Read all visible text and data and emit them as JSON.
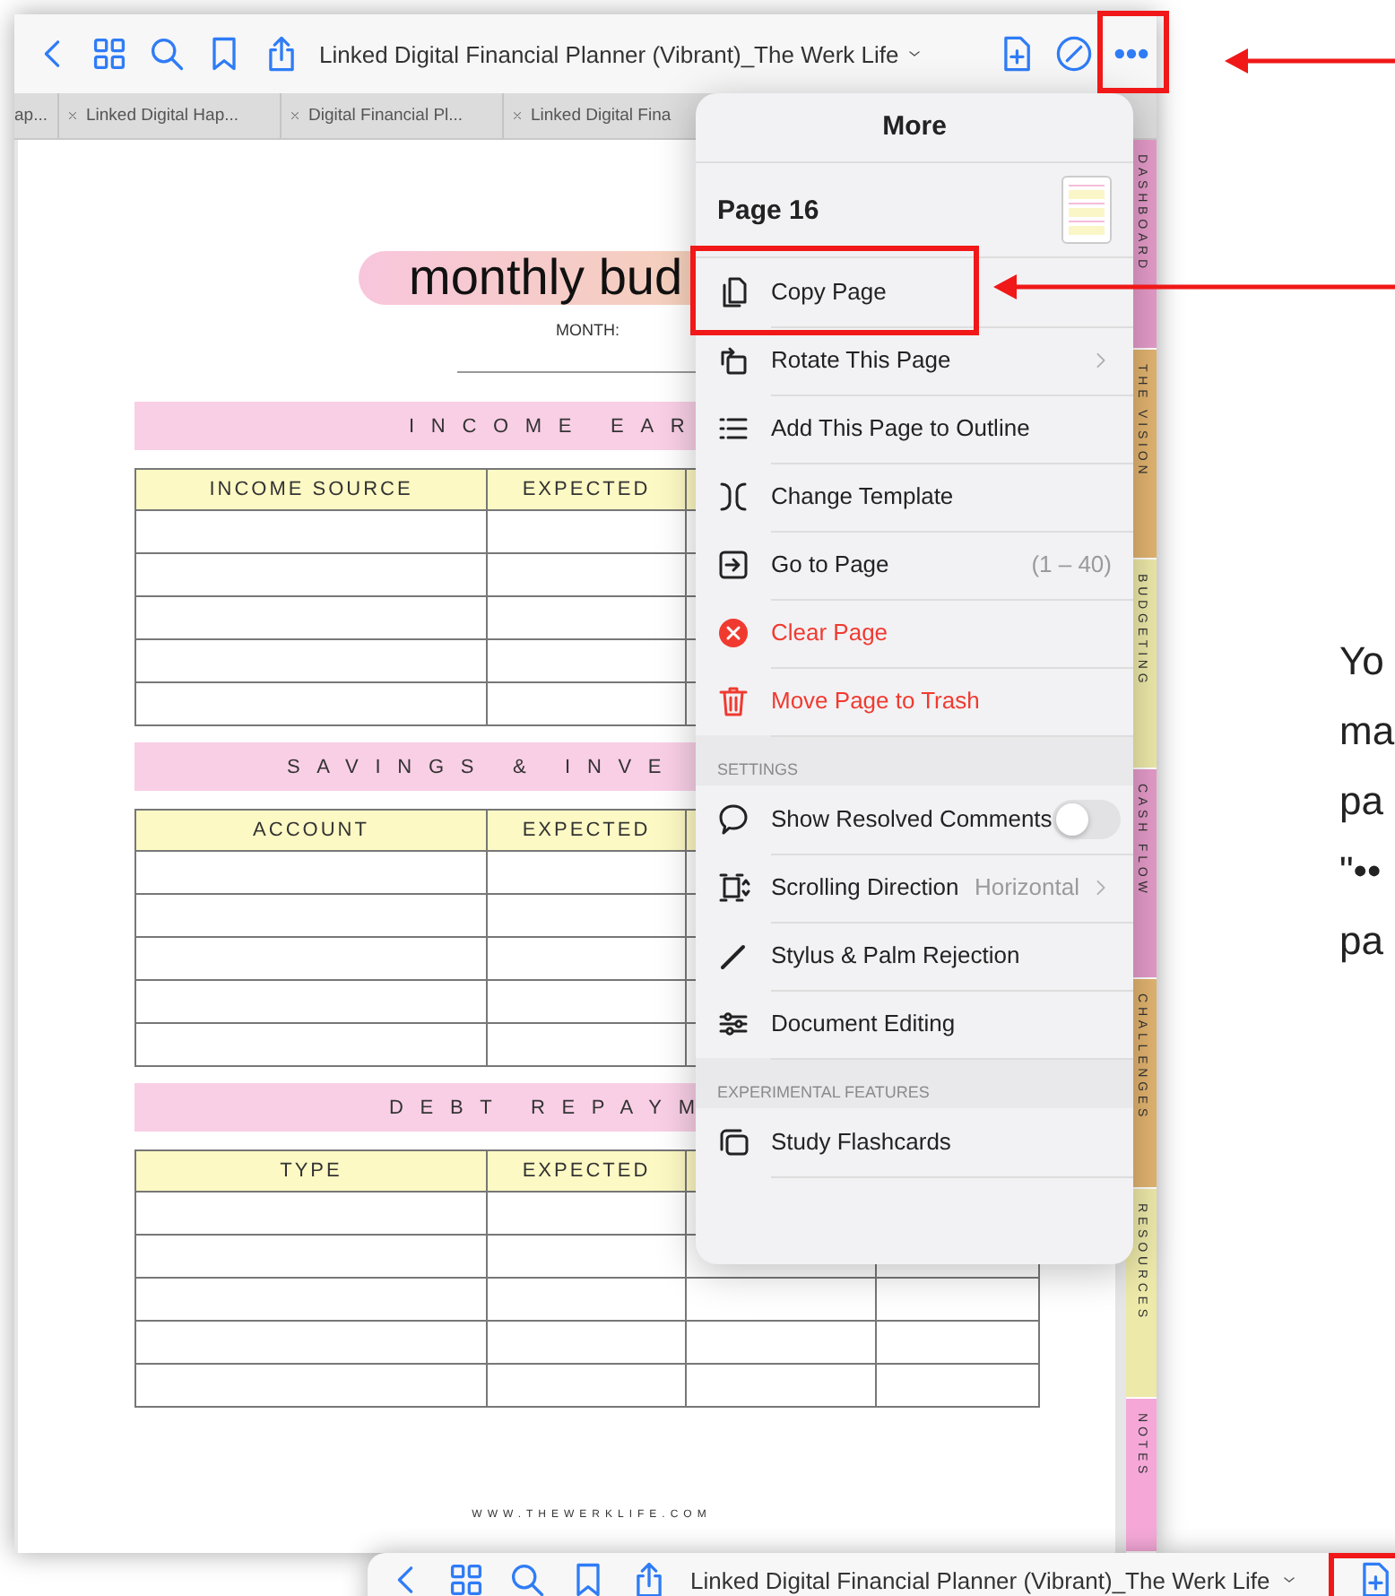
{
  "toolbar": {
    "title": "Linked Digital Financial Planner (Vibrant)_The Werk Life"
  },
  "tabs": [
    {
      "label": "ap...",
      "closable": false
    },
    {
      "label": "Linked Digital Hap...",
      "closable": true
    },
    {
      "label": "Digital Financial Pl...",
      "closable": true
    },
    {
      "label": "Linked Digital Fina",
      "closable": true
    }
  ],
  "page": {
    "title": "monthly bud",
    "month_label": "MONTH:",
    "sections": [
      {
        "title": "INCOME EAR",
        "columns": [
          "INCOME SOURCE",
          "EXPECTED"
        ]
      },
      {
        "title": "SAVINGS & INVE",
        "columns": [
          "ACCOUNT",
          "EXPECTED"
        ]
      },
      {
        "title": "DEBT REPAYM",
        "columns": [
          "TYPE",
          "EXPECTED"
        ]
      }
    ],
    "footer": "WWW.THEWERKLIFE.COM"
  },
  "section_tabs": [
    {
      "label": "DASHBOARD",
      "color": "#e59bc9"
    },
    {
      "label": "THE VISION",
      "color": "#e2b46f"
    },
    {
      "label": "BUDGETING",
      "color": "#ede9a9"
    },
    {
      "label": "CASH FLOW",
      "color": "#e59bc9"
    },
    {
      "label": "CHALLENGES",
      "color": "#e2b46f"
    },
    {
      "label": "RESOURCES",
      "color": "#ede9a9"
    },
    {
      "label": "NOTES",
      "color": "#f5a8d8"
    }
  ],
  "menu": {
    "title": "More",
    "page_label": "Page 16",
    "groups": [
      {
        "items": [
          {
            "label": "Copy Page",
            "kind": "action",
            "disclosure": false
          },
          {
            "label": "Rotate This Page",
            "kind": "action",
            "disclosure": true
          },
          {
            "label": "Add This Page to Outline",
            "kind": "action",
            "disclosure": false
          },
          {
            "label": "Change Template",
            "kind": "action",
            "disclosure": false
          },
          {
            "label": "Go to Page",
            "kind": "action",
            "detail": "(1 – 40)",
            "disclosure": false
          },
          {
            "label": "Clear Page",
            "kind": "destructive",
            "disclosure": false
          },
          {
            "label": "Move Page to Trash",
            "kind": "destructive",
            "disclosure": false
          }
        ]
      },
      {
        "header": "SETTINGS",
        "items": [
          {
            "label": "Show Resolved Comments",
            "kind": "toggle",
            "on": false,
            "disclosure": false
          },
          {
            "label": "Scrolling Direction",
            "kind": "action",
            "detail": "Horizontal",
            "disclosure": true
          },
          {
            "label": "Stylus & Palm Rejection",
            "kind": "action",
            "disclosure": false
          },
          {
            "label": "Document Editing",
            "kind": "action",
            "disclosure": false
          }
        ]
      },
      {
        "header": "EXPERIMENTAL FEATURES",
        "items": [
          {
            "label": "Study Flashcards",
            "kind": "action",
            "disclosure": false
          }
        ]
      }
    ]
  },
  "caption_lines": [
    "Yo",
    "ma",
    "pa",
    "\"••",
    "pa"
  ],
  "second_toolbar": {
    "title": "Linked Digital Financial Planner (Vibrant)_The Werk Life"
  }
}
